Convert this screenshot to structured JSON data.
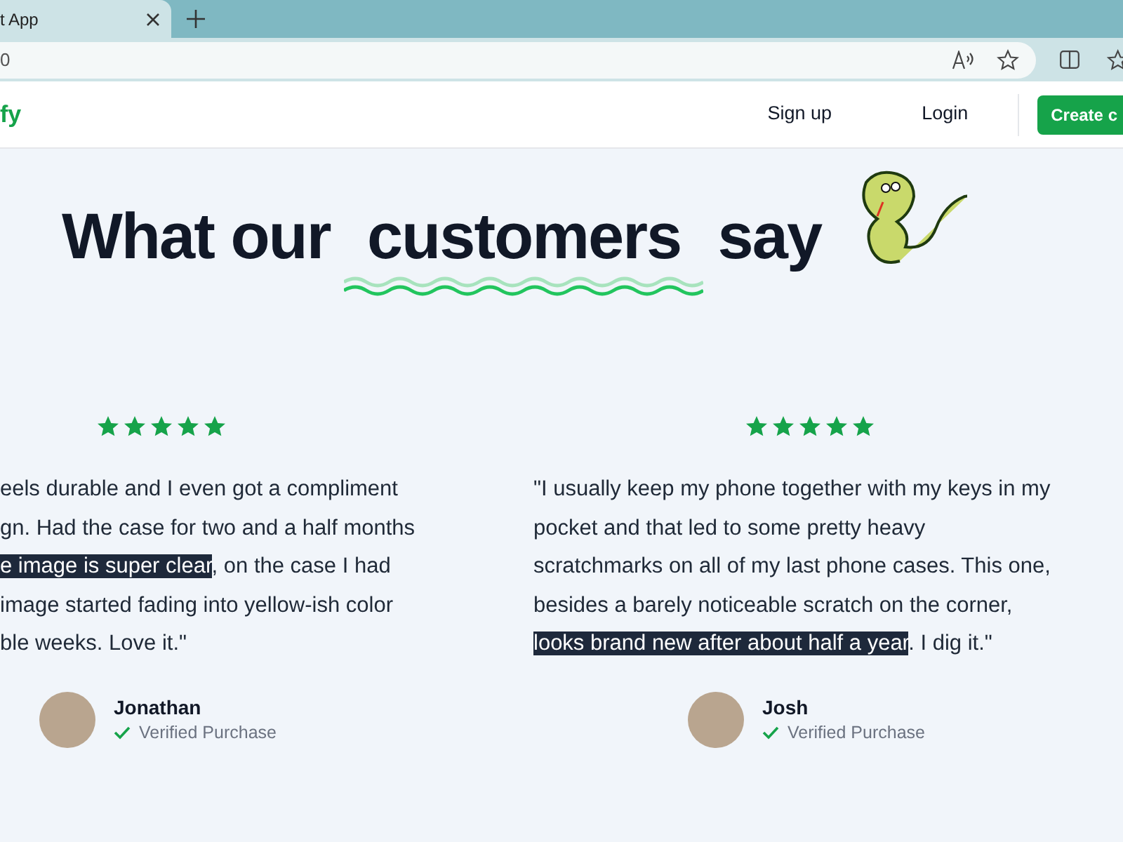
{
  "browser": {
    "tab": {
      "title": "t App"
    },
    "address": "0"
  },
  "header": {
    "logo": "fy",
    "nav": [
      "Sign up",
      "Login"
    ],
    "cta": "Create c"
  },
  "hero": {
    "title_before": "What our",
    "title_highlight": "customers",
    "title_after": "say"
  },
  "reviews": [
    {
      "stars": 5,
      "lines": [
        [
          {
            "text": "eels durable and I even got a compliment",
            "highlight": false
          }
        ],
        [
          {
            "text": "gn. Had the case for two and a half months",
            "highlight": false
          }
        ],
        [
          {
            "text": "e image is super clear",
            "highlight": true
          },
          {
            "text": ", on the case I had",
            "highlight": false
          }
        ],
        [
          {
            "text": "image started fading into yellow-ish color",
            "highlight": false
          }
        ],
        [
          {
            "text": "ble weeks. Love it.\"",
            "highlight": false
          }
        ]
      ],
      "author": "Jonathan",
      "badge": "Verified Purchase"
    },
    {
      "stars": 5,
      "lines": [
        [
          {
            "text": "\"I usually keep my phone together with my keys in my",
            "highlight": false
          }
        ],
        [
          {
            "text": "pocket and that led to some pretty heavy",
            "highlight": false
          }
        ],
        [
          {
            "text": "scratchmarks on all of my last phone cases. This one,",
            "highlight": false
          }
        ],
        [
          {
            "text": "besides a barely noticeable scratch on the corner,",
            "highlight": false
          }
        ],
        [
          {
            "text": "looks brand new after about half a year",
            "highlight": true
          },
          {
            "text": ". I dig it.\"",
            "highlight": false
          }
        ]
      ],
      "author": "Josh",
      "badge": "Verified Purchase"
    }
  ]
}
